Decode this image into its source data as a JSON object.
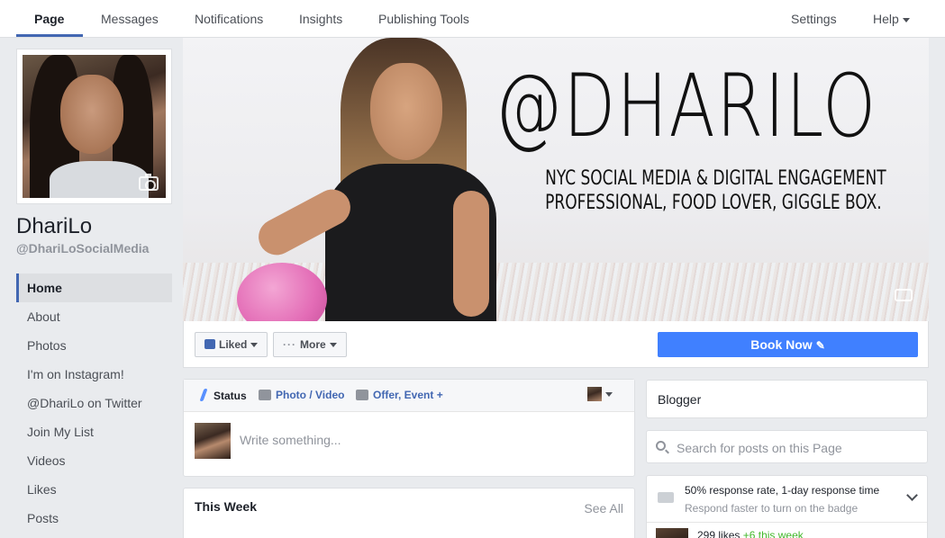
{
  "tabs": [
    {
      "label": "Page",
      "active": true
    },
    {
      "label": "Messages"
    },
    {
      "label": "Notifications"
    },
    {
      "label": "Insights"
    },
    {
      "label": "Publishing Tools"
    }
  ],
  "top_right": {
    "settings": "Settings",
    "help": "Help"
  },
  "page": {
    "name": "DhariLo",
    "handle": "@DhariLoSocialMedia"
  },
  "nav": [
    "Home",
    "About",
    "Photos",
    "I'm on Instagram!",
    "@DhariLo on Twitter",
    "Join My List",
    "Videos",
    "Likes",
    "Posts"
  ],
  "cover": {
    "handle": "@DHARILO",
    "tagline_1": "NYC SOCIAL MEDIA & DIGITAL ENGAGEMENT",
    "tagline_2": "PROFESSIONAL, FOOD LOVER, GIGGLE BOX."
  },
  "actions": {
    "liked": "Liked",
    "more": "More",
    "book_now": "Book Now"
  },
  "composer": {
    "status": "Status",
    "photo_video": "Photo / Video",
    "offer_event": "Offer, Event +",
    "placeholder": "Write something..."
  },
  "this_week": {
    "title": "This Week",
    "see_all": "See All"
  },
  "sidebar_right": {
    "category": "Blogger",
    "search_placeholder": "Search for posts on this Page",
    "response_main": "50% response rate, 1-day response time",
    "response_sub": "Respond faster to turn on the badge",
    "likes": "299 likes",
    "likes_week": "+6 this week"
  },
  "colors": {
    "brand_blue": "#4267b2",
    "button_blue": "#4080ff",
    "green": "#42b72a"
  }
}
